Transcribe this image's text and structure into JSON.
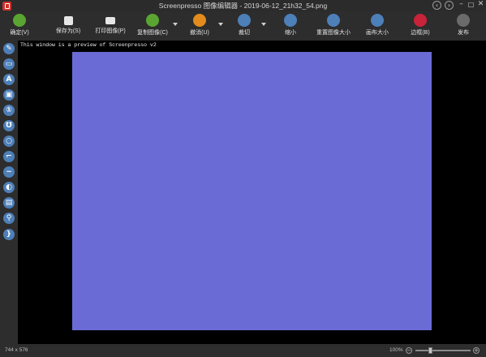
{
  "window": {
    "title": "Screenpresso 图像编辑器 - 2019-06-12_21h32_54.png"
  },
  "toolbar": {
    "buttons": [
      {
        "label": "确定(V)",
        "icon": "checkmark-save-icon",
        "color": "#5aa532"
      },
      {
        "label": "保存为(S)",
        "icon": "floppy-disk-icon",
        "color": "#2d2d2d"
      },
      {
        "label": "打印图像(P)",
        "icon": "printer-icon",
        "color": "#2d2d2d"
      },
      {
        "label": "复制图像(C)",
        "icon": "copy-icon",
        "color": "#5aa532"
      },
      {
        "label": "撤消(U)",
        "icon": "undo-icon",
        "color": "#e38b1c"
      },
      {
        "label": "裁切",
        "icon": "crop-icon",
        "color": "#4d7fb8"
      },
      {
        "label": "缩小",
        "icon": "shrink-icon",
        "color": "#4d7fb8"
      },
      {
        "label": "重置图像大小",
        "icon": "resize-image-icon",
        "color": "#4d7fb8"
      },
      {
        "label": "画布大小",
        "icon": "canvas-size-icon",
        "color": "#4d7fb8"
      },
      {
        "label": "边框(B)",
        "icon": "border-frame-icon",
        "color": "#c8233a"
      },
      {
        "label": "发布",
        "icon": "cloud-publish-icon",
        "color": "#6b6b6b"
      }
    ]
  },
  "sidebar": {
    "tools": [
      {
        "icon": "pen-icon",
        "glyph": "✎"
      },
      {
        "icon": "rectangle-icon",
        "glyph": "▭"
      },
      {
        "icon": "text-icon",
        "glyph": "A"
      },
      {
        "icon": "callout-icon",
        "glyph": "▣"
      },
      {
        "icon": "step-number-icon",
        "glyph": "①"
      },
      {
        "icon": "magnet-icon",
        "glyph": "Ʊ"
      },
      {
        "icon": "ellipse-icon",
        "glyph": "○"
      },
      {
        "icon": "lasso-icon",
        "glyph": "⌐"
      },
      {
        "icon": "curve-icon",
        "glyph": "~"
      },
      {
        "icon": "blur-drop-icon",
        "glyph": "◐"
      },
      {
        "icon": "image-insert-icon",
        "glyph": "▤"
      },
      {
        "icon": "magnifier-icon",
        "glyph": "⚲"
      },
      {
        "icon": "bracket-icon",
        "glyph": "}"
      }
    ]
  },
  "canvas": {
    "preview_note": "This window is a preview of Screenpresso v2",
    "image_color": "#6b6bd6"
  },
  "statusbar": {
    "dimensions": "744 x 576",
    "zoom": "100%",
    "zoom_level": 0.25
  }
}
